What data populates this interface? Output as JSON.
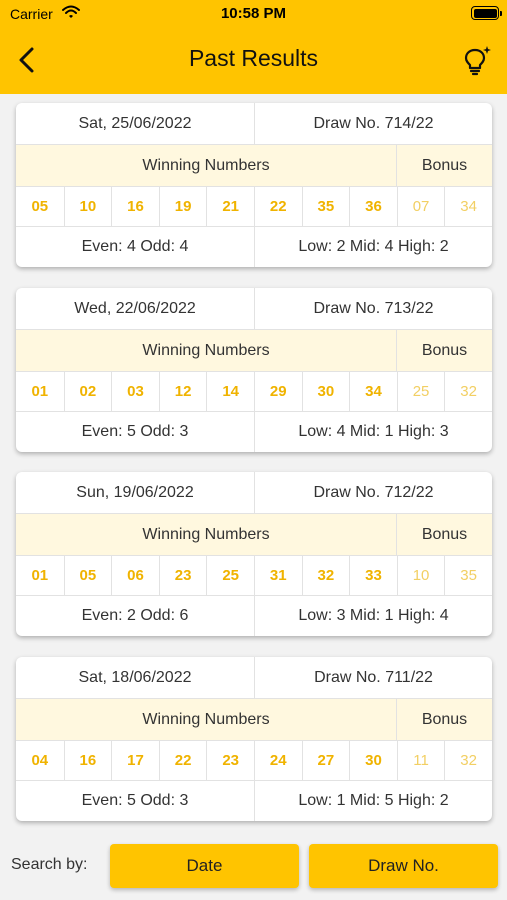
{
  "status_bar": {
    "carrier": "Carrier",
    "time": "10:58 PM"
  },
  "header": {
    "title": "Past Results",
    "back_icon": "chevron-left-icon",
    "tip_icon": "lightbulb-sparkle-icon"
  },
  "labels": {
    "winning_numbers": "Winning Numbers",
    "bonus": "Bonus"
  },
  "results": [
    {
      "date": "Sat, 25/06/2022",
      "draw": "Draw No. 714/22",
      "numbers": [
        "05",
        "10",
        "16",
        "19",
        "21",
        "22",
        "35",
        "36"
      ],
      "bonus": [
        "07",
        "34"
      ],
      "even_odd": "Even: 4 Odd: 4",
      "low_mid_high": "Low: 2 Mid: 4 High: 2"
    },
    {
      "date": "Wed, 22/06/2022",
      "draw": "Draw No. 713/22",
      "numbers": [
        "01",
        "02",
        "03",
        "12",
        "14",
        "29",
        "30",
        "34"
      ],
      "bonus": [
        "25",
        "32"
      ],
      "even_odd": "Even: 5 Odd: 3",
      "low_mid_high": "Low: 4 Mid: 1 High: 3"
    },
    {
      "date": "Sun, 19/06/2022",
      "draw": "Draw No. 712/22",
      "numbers": [
        "01",
        "05",
        "06",
        "23",
        "25",
        "31",
        "32",
        "33"
      ],
      "bonus": [
        "10",
        "35"
      ],
      "even_odd": "Even: 2 Odd: 6",
      "low_mid_high": "Low: 3 Mid: 1 High: 4"
    },
    {
      "date": "Sat, 18/06/2022",
      "draw": "Draw No. 711/22",
      "numbers": [
        "04",
        "16",
        "17",
        "22",
        "23",
        "24",
        "27",
        "30"
      ],
      "bonus": [
        "11",
        "32"
      ],
      "even_odd": "Even: 5 Odd: 3",
      "low_mid_high": "Low: 1 Mid: 5 High: 2"
    }
  ],
  "footer": {
    "search_label": "Search by:",
    "date_button": "Date",
    "draw_button": "Draw No."
  },
  "colors": {
    "accent": "#ffc400",
    "number": "#f0b300",
    "bonus_number": "#f2cf63",
    "header_row": "#fff8df"
  }
}
